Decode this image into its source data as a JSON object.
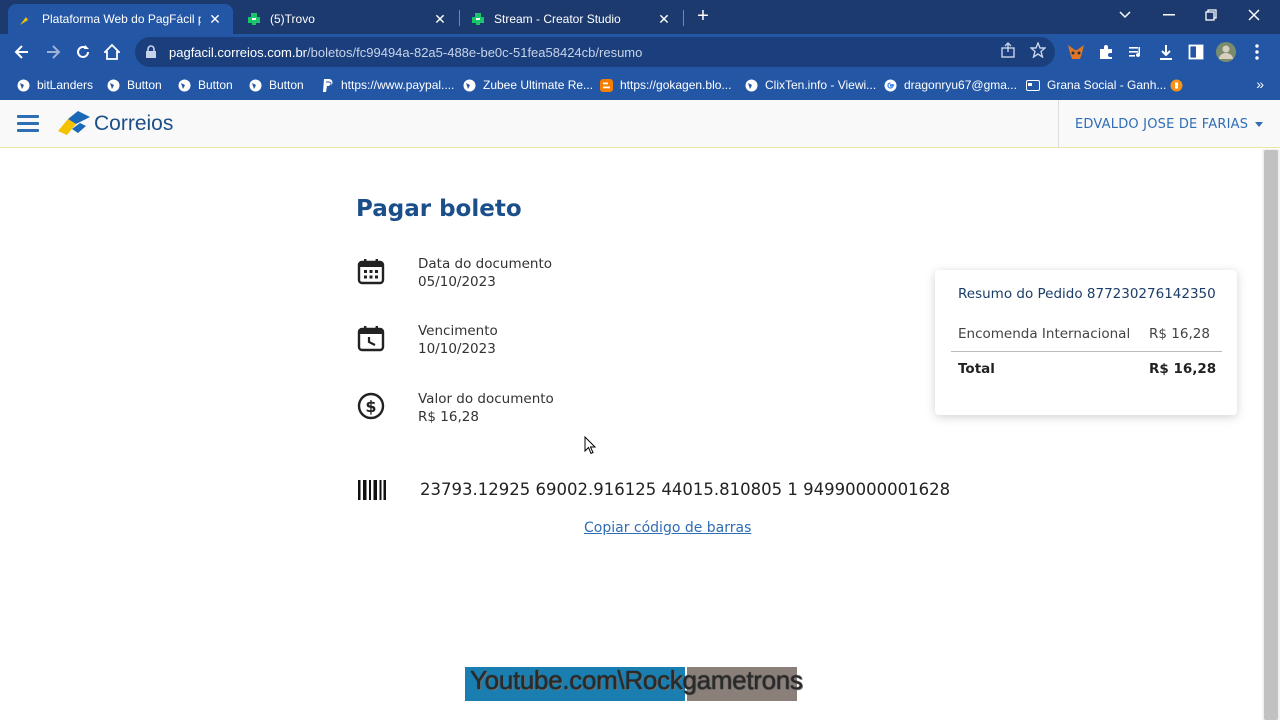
{
  "browser": {
    "tabs": [
      {
        "title": "Plataforma Web do PagFácil par",
        "icon": "pagfacil-favicon",
        "active": true
      },
      {
        "title": "(5)Trovo",
        "icon": "trovo-favicon",
        "active": false
      },
      {
        "title": "Stream - Creator Studio",
        "icon": "trovo-favicon",
        "active": false
      }
    ],
    "new_tab_label": "+",
    "url_host": "pagfacil.correios.com.br",
    "url_path": "/boletos/fc99494a-82a5-488e-be0c-51fea58424cb/resumo",
    "bookmarks": [
      {
        "label": "bitLanders",
        "icon": "globe-icon"
      },
      {
        "label": "Button",
        "icon": "globe-icon"
      },
      {
        "label": "Button",
        "icon": "globe-icon"
      },
      {
        "label": "Button",
        "icon": "globe-icon"
      },
      {
        "label": "https://www.paypal....",
        "icon": "paypal-icon"
      },
      {
        "label": "Zubee Ultimate Re...",
        "icon": "globe-icon"
      },
      {
        "label": "https://gokagen.blo...",
        "icon": "blogger-icon"
      },
      {
        "label": "ClixTen.info - Viewi...",
        "icon": "globe-icon"
      },
      {
        "label": "dragonryu67@gma...",
        "icon": "google-icon"
      },
      {
        "label": "Grana Social - Ganh...",
        "icon": "card-icon"
      }
    ],
    "bookmarks_more": "»",
    "colors": {
      "tabstrip": "#1c3a6e",
      "toolbar": "#2356a5"
    }
  },
  "header": {
    "logo_text": "Correios",
    "user_name": "EDVALDO JOSE DE FARIAS"
  },
  "main": {
    "title": "Pagar boleto",
    "details": [
      {
        "label": "Data do documento",
        "value": "05/10/2023",
        "icon": "calendar-icon"
      },
      {
        "label": "Vencimento",
        "value": "10/10/2023",
        "icon": "calendar-clock-icon"
      },
      {
        "label": "Valor do documento",
        "value": "R$ 16,28",
        "icon": "dollar-circle-icon"
      }
    ],
    "barcode": "23793.12925 69002.916125 44015.810805 1 94990000001628",
    "copy_link": "Copiar código de barras"
  },
  "summary": {
    "title": "Resumo do Pedido 877230276142350",
    "item_label": "Encomenda Internacional",
    "item_value": "R$ 16,28",
    "total_label": "Total",
    "total_value": "R$ 16,28"
  },
  "footer": {
    "watermark": "Youtube.com\\Rockgametrons"
  },
  "colors": {
    "brand_blue": "#1b4f8a",
    "link_blue": "#2f6db5",
    "button_blue": "#1a7fb0",
    "button_gray": "#8a8079"
  }
}
